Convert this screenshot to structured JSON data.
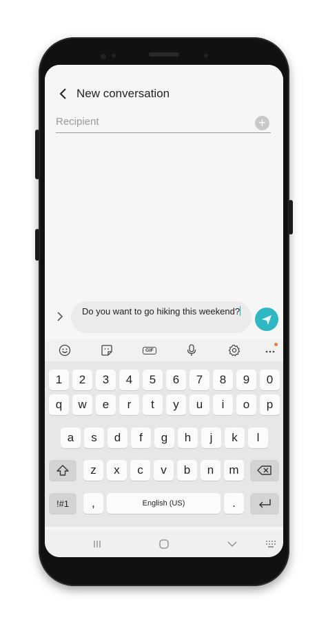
{
  "header": {
    "title": "New conversation"
  },
  "recipient": {
    "placeholder": "Recipient",
    "value": ""
  },
  "compose": {
    "message": "Do you want to go hiking this weekend?"
  },
  "toolbar": {
    "items": [
      "emoji-icon",
      "sticker-icon",
      "gif-icon",
      "microphone-icon",
      "settings-icon",
      "more-icon"
    ],
    "gif_label": "GIF",
    "badge_color": "#f07a3a"
  },
  "keyboard": {
    "row_numbers": [
      "1",
      "2",
      "3",
      "4",
      "5",
      "6",
      "7",
      "8",
      "9",
      "0"
    ],
    "row_1": [
      "q",
      "w",
      "e",
      "r",
      "t",
      "y",
      "u",
      "i",
      "o",
      "p"
    ],
    "row_2": [
      "a",
      "s",
      "d",
      "f",
      "g",
      "h",
      "j",
      "k",
      "l"
    ],
    "row_3": [
      "z",
      "x",
      "c",
      "v",
      "b",
      "n",
      "m"
    ],
    "symbols_label": "!#1",
    "comma_label": ",",
    "space_label": "English (US)",
    "period_label": "."
  },
  "colors": {
    "accent": "#30b7c4",
    "caret": "#1bb1c5"
  }
}
